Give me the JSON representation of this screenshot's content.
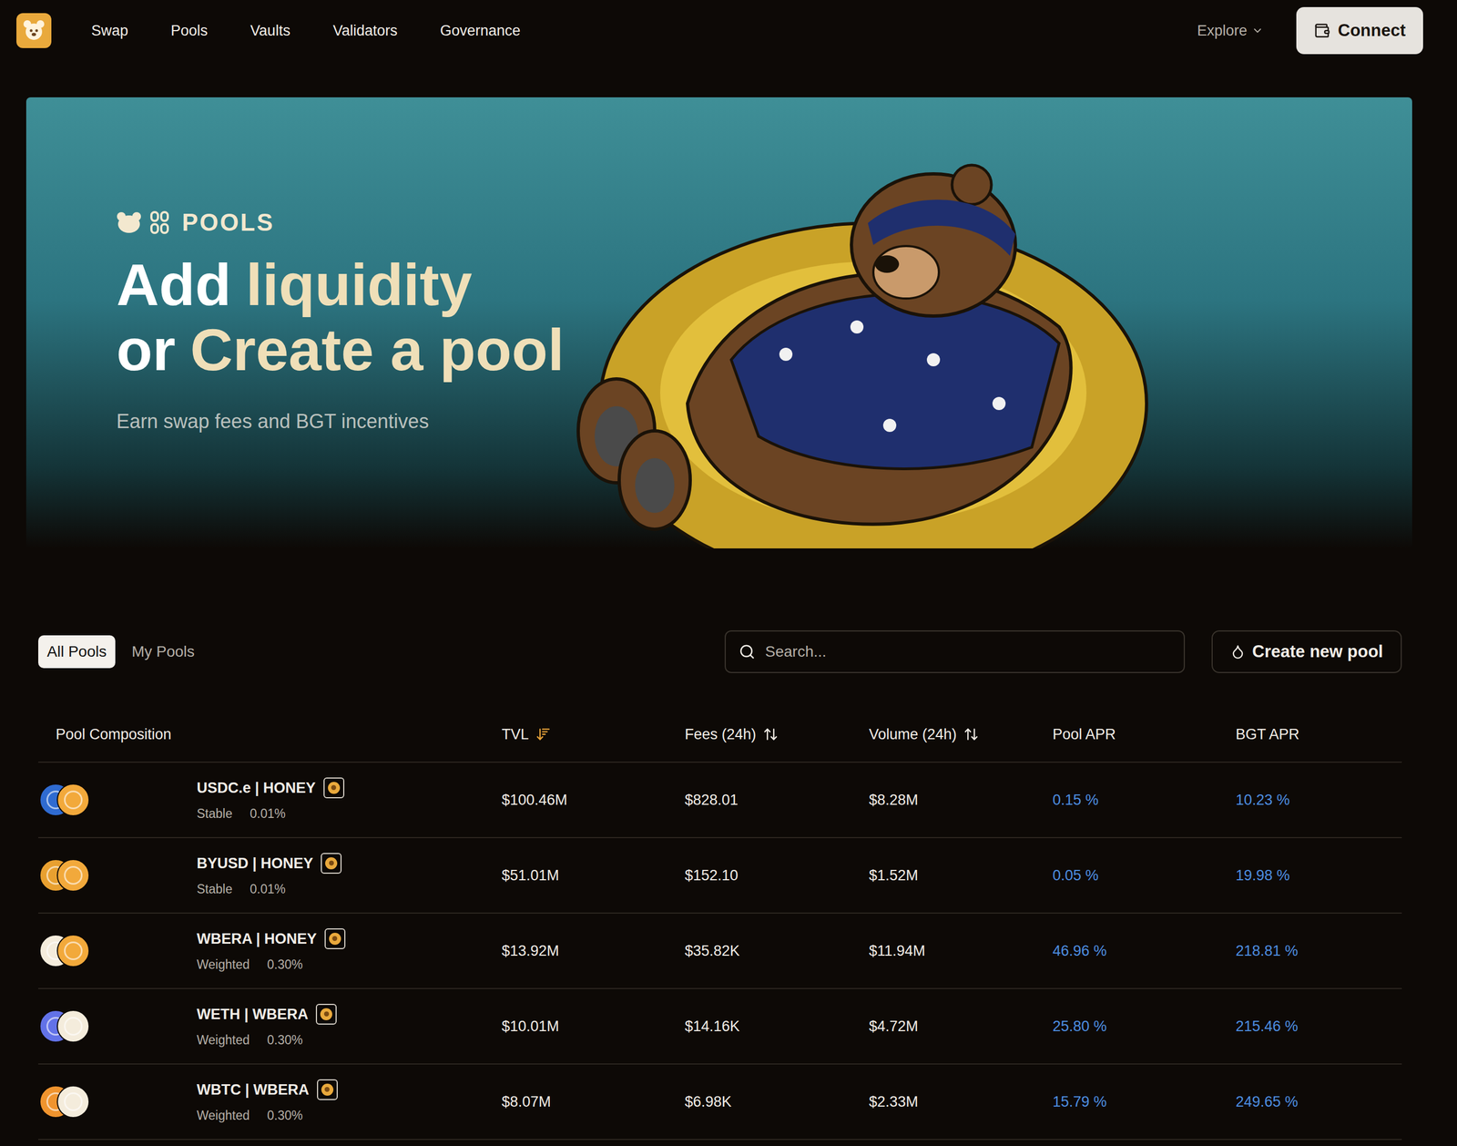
{
  "header": {
    "nav": [
      {
        "label": "Swap"
      },
      {
        "label": "Pools"
      },
      {
        "label": "Vaults"
      },
      {
        "label": "Validators"
      },
      {
        "label": "Governance"
      }
    ],
    "explore": "Explore",
    "connect": "Connect"
  },
  "hero": {
    "eyebrow": "POOLS",
    "title_lines": [
      [
        {
          "text": "Add",
          "highlight": false
        },
        {
          "text": "liquidity",
          "highlight": true
        }
      ],
      [
        {
          "text": "or",
          "highlight": false
        },
        {
          "text": "Create a pool",
          "highlight": true
        }
      ]
    ],
    "subtitle": "Earn swap fees and BGT incentives"
  },
  "tabs": [
    {
      "label": "All Pools",
      "selected": true
    },
    {
      "label": "My Pools",
      "selected": false
    }
  ],
  "search": {
    "placeholder": "Search..."
  },
  "create_button": "Create new pool",
  "table": {
    "columns": [
      {
        "label": "Pool Composition",
        "sort": "none"
      },
      {
        "label": "TVL",
        "sort": "active"
      },
      {
        "label": "Fees (24h)",
        "sort": "available"
      },
      {
        "label": "Volume (24h)",
        "sort": "available"
      },
      {
        "label": "Pool APR",
        "sort": "none"
      },
      {
        "label": "BGT APR",
        "sort": "none"
      }
    ],
    "rows": [
      {
        "name": "USDC.e | HONEY",
        "type": "Stable",
        "fee": "0.01%",
        "tvl": "$100.46M",
        "fees": "$828.01",
        "volume": "$8.28M",
        "pool_apr": "0.15 %",
        "bgt_apr": "10.23 %",
        "tokens": [
          {
            "color": "#2f6bd1"
          },
          {
            "color": "#f2a93b"
          }
        ]
      },
      {
        "name": "BYUSD | HONEY",
        "type": "Stable",
        "fee": "0.01%",
        "tvl": "$51.01M",
        "fees": "$152.10",
        "volume": "$1.52M",
        "pool_apr": "0.05 %",
        "bgt_apr": "19.98 %",
        "tokens": [
          {
            "color": "#e8a030"
          },
          {
            "color": "#f2a93b"
          }
        ]
      },
      {
        "name": "WBERA | HONEY",
        "type": "Weighted",
        "fee": "0.30%",
        "tvl": "$13.92M",
        "fees": "$35.82K",
        "volume": "$11.94M",
        "pool_apr": "46.96 %",
        "bgt_apr": "218.81 %",
        "tokens": [
          {
            "color": "#f4ecdc"
          },
          {
            "color": "#f2a93b"
          }
        ]
      },
      {
        "name": "WETH | WBERA",
        "type": "Weighted",
        "fee": "0.30%",
        "tvl": "$10.01M",
        "fees": "$14.16K",
        "volume": "$4.72M",
        "pool_apr": "25.80 %",
        "bgt_apr": "215.46 %",
        "tokens": [
          {
            "color": "#6272e8"
          },
          {
            "color": "#f4ecdc"
          }
        ]
      },
      {
        "name": "WBTC | WBERA",
        "type": "Weighted",
        "fee": "0.30%",
        "tvl": "$8.07M",
        "fees": "$6.98K",
        "volume": "$2.33M",
        "pool_apr": "15.79 %",
        "bgt_apr": "249.65 %",
        "tokens": [
          {
            "color": "#f0942e"
          },
          {
            "color": "#f4ecdc"
          }
        ]
      }
    ]
  }
}
